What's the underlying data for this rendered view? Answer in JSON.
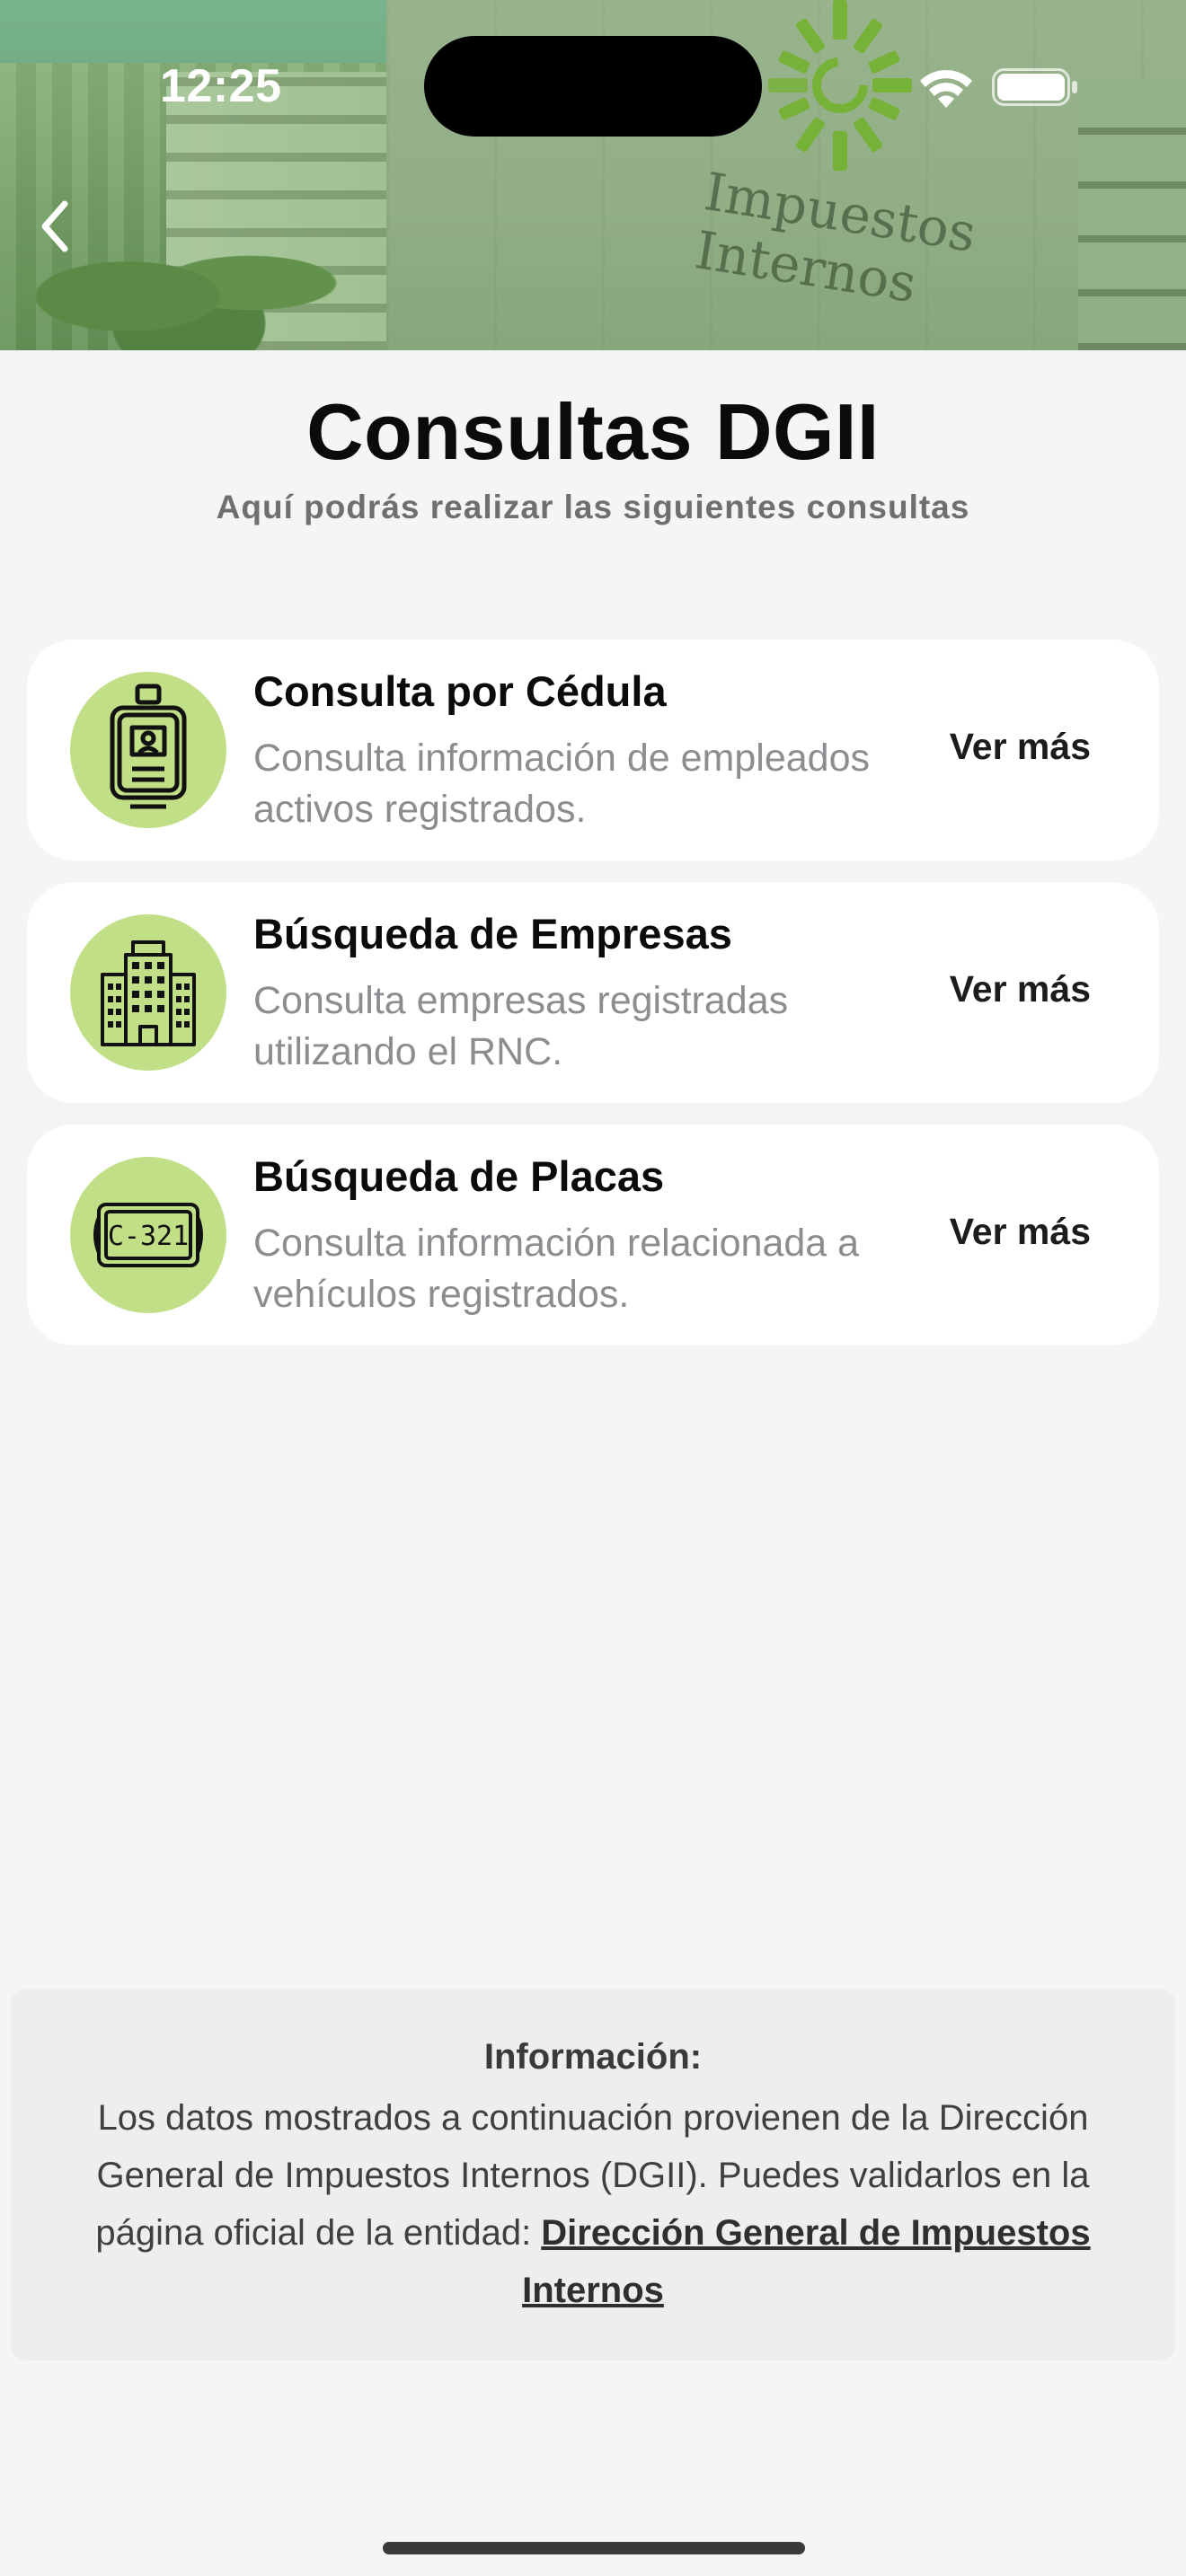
{
  "status_bar": {
    "time": "12:25"
  },
  "hero": {
    "sign_line1": "Impuestos",
    "sign_line2": "Internos"
  },
  "header": {
    "title": "Consultas DGII",
    "subtitle": "Aquí podrás realizar las siguientes consultas"
  },
  "cards": [
    {
      "title": "Consulta por Cédula",
      "description": "Consulta información de empleados activos registrados.",
      "link": "Ver más",
      "icon": "id-badge-icon"
    },
    {
      "title": "Búsqueda de Empresas",
      "description": "Consulta empresas registradas utilizando el RNC.",
      "link": "Ver más",
      "icon": "building-icon"
    },
    {
      "title": "Búsqueda de Placas",
      "description": "Consulta información relacionada a vehículos registrados.",
      "link": "Ver más",
      "icon": "license-plate-icon",
      "plate_text": "C-321"
    }
  ],
  "info": {
    "title": "Información:",
    "body": "Los datos mostrados a continuación provienen de la Dirección General de Impuestos Internos (DGII). Puedes validarlos en la página oficial de la entidad: ",
    "link": "Dirección General de Impuestos Internos"
  },
  "colors": {
    "accent_green": "#c0df87",
    "background": "#f4f5f7",
    "card": "#ffffff",
    "info_box": "#eeeeef"
  }
}
